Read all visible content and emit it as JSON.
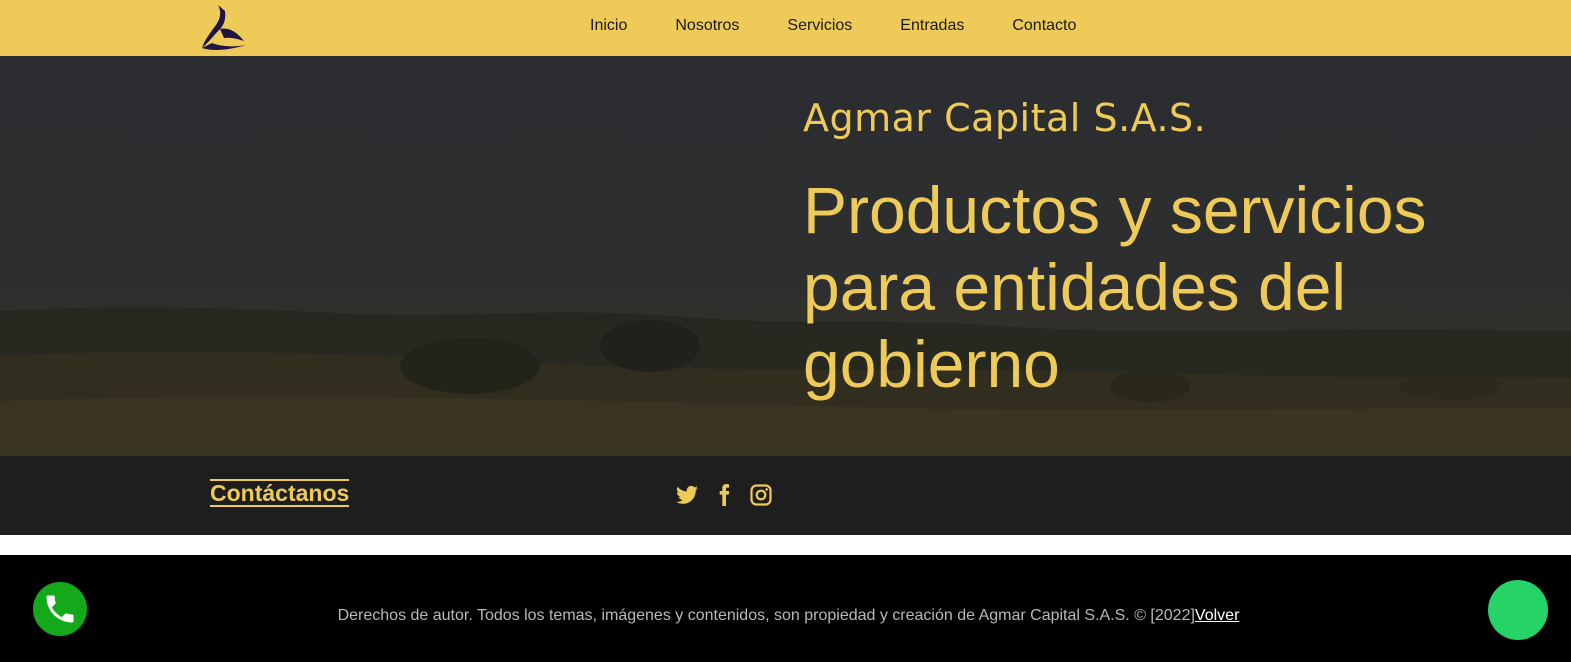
{
  "nav": {
    "logo_icon": "agmar-logo-icon",
    "links": [
      "Inicio",
      "Nosotros",
      "Servicios",
      "Entradas",
      "Contacto"
    ]
  },
  "hero": {
    "company": "Agmar Capital S.A.S.",
    "heading": "Productos y servicios para entidades del gobierno"
  },
  "strip": {
    "contact_label": "Contáctanos",
    "social_icons": [
      "twitter-icon",
      "facebook-icon",
      "instagram-icon"
    ]
  },
  "footer": {
    "text": "Derechos de autor. Todos los temas, imágenes y contenidos, son propiedad y creación de Agmar Capital S.A.S. © [2022]",
    "back_link": "Volver"
  },
  "floating": {
    "call_icon": "phone-icon",
    "chat_icon": "whatsapp-icon"
  },
  "colors": {
    "accent": "#eecb58",
    "strip_bg": "#1e1e1e",
    "footer_bg": "#000000",
    "call_green": "#13a91b",
    "whatsapp_green": "#25d366"
  }
}
